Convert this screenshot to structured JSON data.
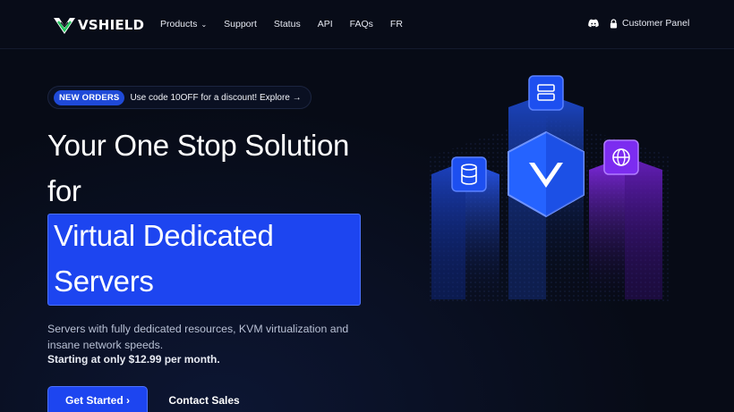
{
  "brand": {
    "name": "VSHIELD"
  },
  "nav": {
    "items": [
      {
        "label": "Products",
        "dropdown": true
      },
      {
        "label": "Support"
      },
      {
        "label": "Status"
      },
      {
        "label": "API"
      },
      {
        "label": "FAQs"
      },
      {
        "label": "FR"
      }
    ],
    "discord_icon": "discord-icon",
    "panel": {
      "label": "Customer Panel",
      "icon": "lock-icon"
    }
  },
  "promo": {
    "badge": "NEW ORDERS",
    "text": "Use code 10OFF for a discount! Explore →"
  },
  "hero": {
    "line1": "Your One Stop Solution",
    "line2": "for",
    "highlight1": "Virtual Dedicated",
    "highlight2": "Servers",
    "description": "Servers with fully dedicated resources, KVM virtualization and insane network speeds.",
    "price_line": "Starting at only $12.99 per month."
  },
  "cta": {
    "primary": "Get Started ›",
    "secondary": "Contact Sales"
  },
  "colors": {
    "background": "#070b16",
    "accent": "#1d45f0",
    "accent_border": "#4c72ff",
    "purple": "#7b2ff0"
  },
  "illustration": {
    "icons": [
      "server-icon",
      "database-icon",
      "shield-logo-icon",
      "globe-icon"
    ]
  }
}
